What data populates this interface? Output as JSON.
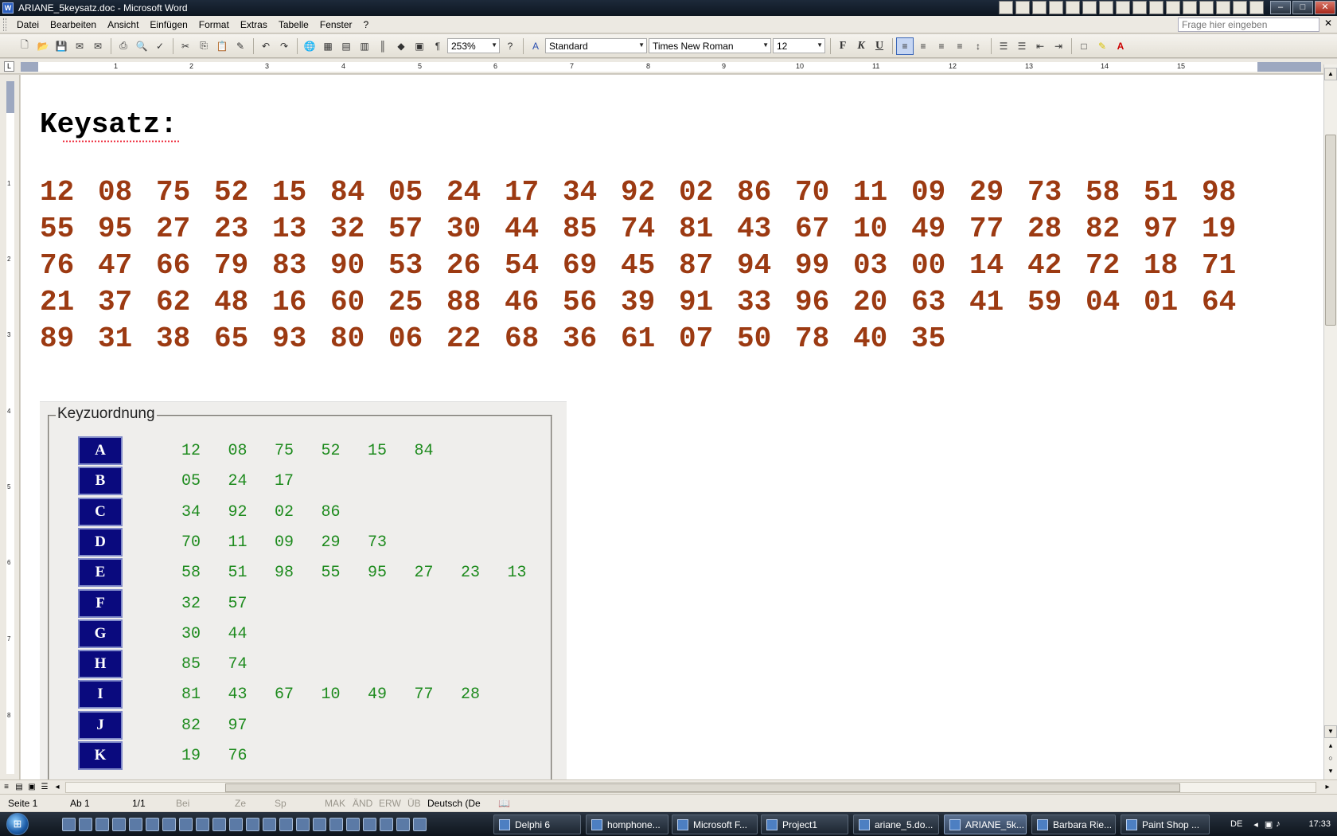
{
  "window": {
    "title": "ARIANE_5keysatz.doc - Microsoft Word",
    "app_icon": "word-icon"
  },
  "menu": {
    "items": [
      "Datei",
      "Bearbeiten",
      "Ansicht",
      "Einfügen",
      "Format",
      "Extras",
      "Tabelle",
      "Fenster",
      "?"
    ],
    "help_placeholder": "Frage hier eingeben"
  },
  "toolbar": {
    "zoom": "253%",
    "style": "Standard",
    "font": "Times New Roman",
    "size": "12",
    "bold_label": "F",
    "italic_label": "K",
    "underline_label": "U"
  },
  "ruler": {
    "numbers": [
      "1",
      "2",
      "3",
      "4",
      "5",
      "6",
      "7",
      "8",
      "9",
      "10",
      "11",
      "12",
      "13",
      "14",
      "15"
    ],
    "vnumbers": [
      "1",
      "2",
      "3",
      "4",
      "5",
      "6",
      "7",
      "8"
    ]
  },
  "document": {
    "heading": "Keysatz:",
    "number_lines": [
      [
        "12",
        "08",
        "75",
        "52",
        "15",
        "84",
        "05",
        "24",
        "17",
        "34",
        "92",
        "02",
        "86",
        "70",
        "11",
        "09",
        "29",
        "73",
        "58",
        "51",
        "98"
      ],
      [
        "55",
        "95",
        "27",
        "23",
        "13",
        "32",
        "57",
        "30",
        "44",
        "85",
        "74",
        "81",
        "43",
        "67",
        "10",
        "49",
        "77",
        "28",
        "82",
        "97",
        "19"
      ],
      [
        "76",
        "47",
        "66",
        "79",
        "83",
        "90",
        "53",
        "26",
        "54",
        "69",
        "45",
        "87",
        "94",
        "99",
        "03",
        "00",
        "14",
        "42",
        "72",
        "18",
        "71"
      ],
      [
        "21",
        "37",
        "62",
        "48",
        "16",
        "60",
        "25",
        "88",
        "46",
        "56",
        "39",
        "91",
        "33",
        "96",
        "20",
        "63",
        "41",
        "59",
        "04",
        "01",
        "64"
      ],
      [
        "89",
        "31",
        "38",
        "65",
        "93",
        "80",
        "06",
        "22",
        "68",
        "36",
        "61",
        "07",
        "50",
        "78",
        "40",
        "35"
      ]
    ],
    "key_table": {
      "legend": "Keyzuordnung",
      "rows": [
        {
          "letter": "A",
          "values": [
            "12",
            "08",
            "75",
            "52",
            "15",
            "84"
          ]
        },
        {
          "letter": "B",
          "values": [
            "05",
            "24",
            "17"
          ]
        },
        {
          "letter": "C",
          "values": [
            "34",
            "92",
            "02",
            "86"
          ]
        },
        {
          "letter": "D",
          "values": [
            "70",
            "11",
            "09",
            "29",
            "73"
          ]
        },
        {
          "letter": "E",
          "values": [
            "58",
            "51",
            "98",
            "55",
            "95",
            "27",
            "23",
            "13"
          ]
        },
        {
          "letter": "F",
          "values": [
            "32",
            "57"
          ]
        },
        {
          "letter": "G",
          "values": [
            "30",
            "44"
          ]
        },
        {
          "letter": "H",
          "values": [
            "85",
            "74"
          ]
        },
        {
          "letter": "I",
          "values": [
            "81",
            "43",
            "67",
            "10",
            "49",
            "77",
            "28"
          ]
        },
        {
          "letter": "J",
          "values": [
            "82",
            "97"
          ]
        },
        {
          "letter": "K",
          "values": [
            "19",
            "76"
          ]
        }
      ]
    }
  },
  "statusbar": {
    "page": "Seite 1",
    "section": "Ab 1",
    "pages": "1/1",
    "at": "Bei",
    "line": "Ze",
    "column": "Sp",
    "mak": "MAK",
    "and": "ÄND",
    "erw": "ERW",
    "ub": "ÜB",
    "language": "Deutsch (De"
  },
  "taskbar": {
    "tasks": [
      {
        "label": "Delphi 6",
        "active": false
      },
      {
        "label": "homphone...",
        "active": false
      },
      {
        "label": "Microsoft F...",
        "active": false
      },
      {
        "label": "Project1",
        "active": false
      },
      {
        "label": "ariane_5.do...",
        "active": false
      },
      {
        "label": "ARIANE_5k...",
        "active": true
      },
      {
        "label": "Barbara Rie...",
        "active": false
      },
      {
        "label": "Paint Shop ...",
        "active": false
      }
    ],
    "language": "DE",
    "clock": "17:33"
  },
  "colors": {
    "number_text": "#9c3a12",
    "key_letter_bg": "#0a0a7e",
    "key_values": "#1e8b1e"
  }
}
